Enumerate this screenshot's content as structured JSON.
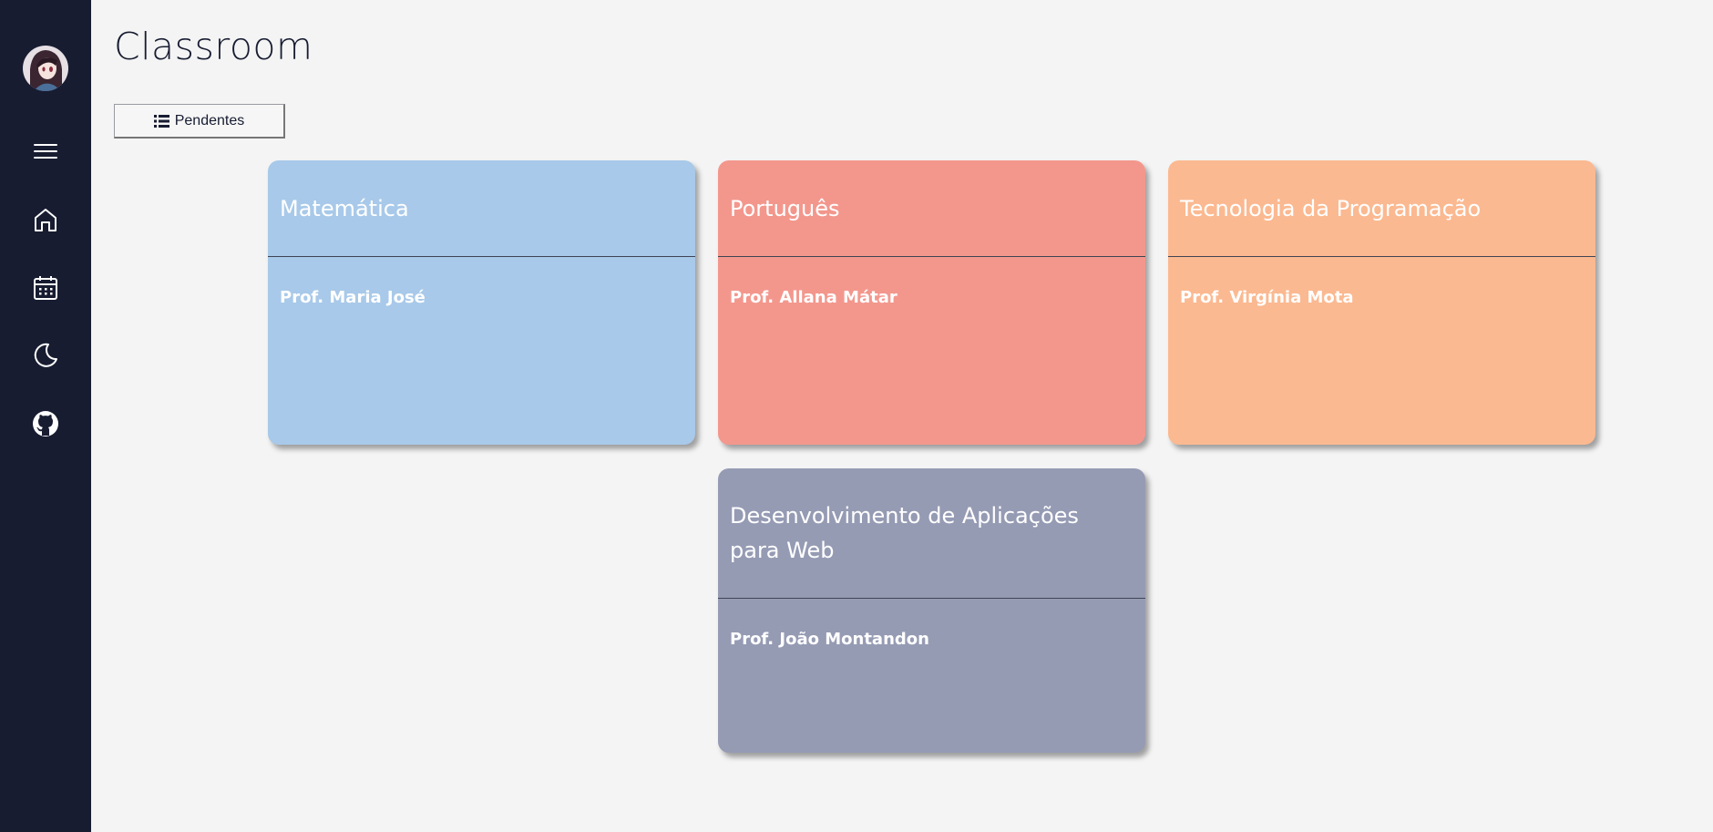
{
  "app": {
    "title": "Classroom"
  },
  "sidebar": {
    "items": [
      {
        "icon": "avatar",
        "label": ""
      },
      {
        "icon": "menu-icon"
      },
      {
        "icon": "home-icon"
      },
      {
        "icon": "calendar-icon"
      },
      {
        "icon": "moon-icon"
      },
      {
        "icon": "github-icon"
      }
    ],
    "background": "#171c31"
  },
  "toolbar": {
    "pending_icon": "list-icon",
    "pending_label": "Pendentes"
  },
  "courses": [
    {
      "name": "Matemática",
      "teacher": "Prof. Maria José",
      "color": "#a8c9e9"
    },
    {
      "name": "Português",
      "teacher": "Prof. Allana Mátar",
      "color": "#f3978d"
    },
    {
      "name": "Tecnologia da Programação",
      "teacher": "Prof. Virgínia Mota",
      "color": "#fbb991"
    },
    {
      "name": "Desenvolvimento de Aplicações para Web",
      "teacher": "Prof. João Montandon",
      "color": "#969bb4"
    }
  ]
}
